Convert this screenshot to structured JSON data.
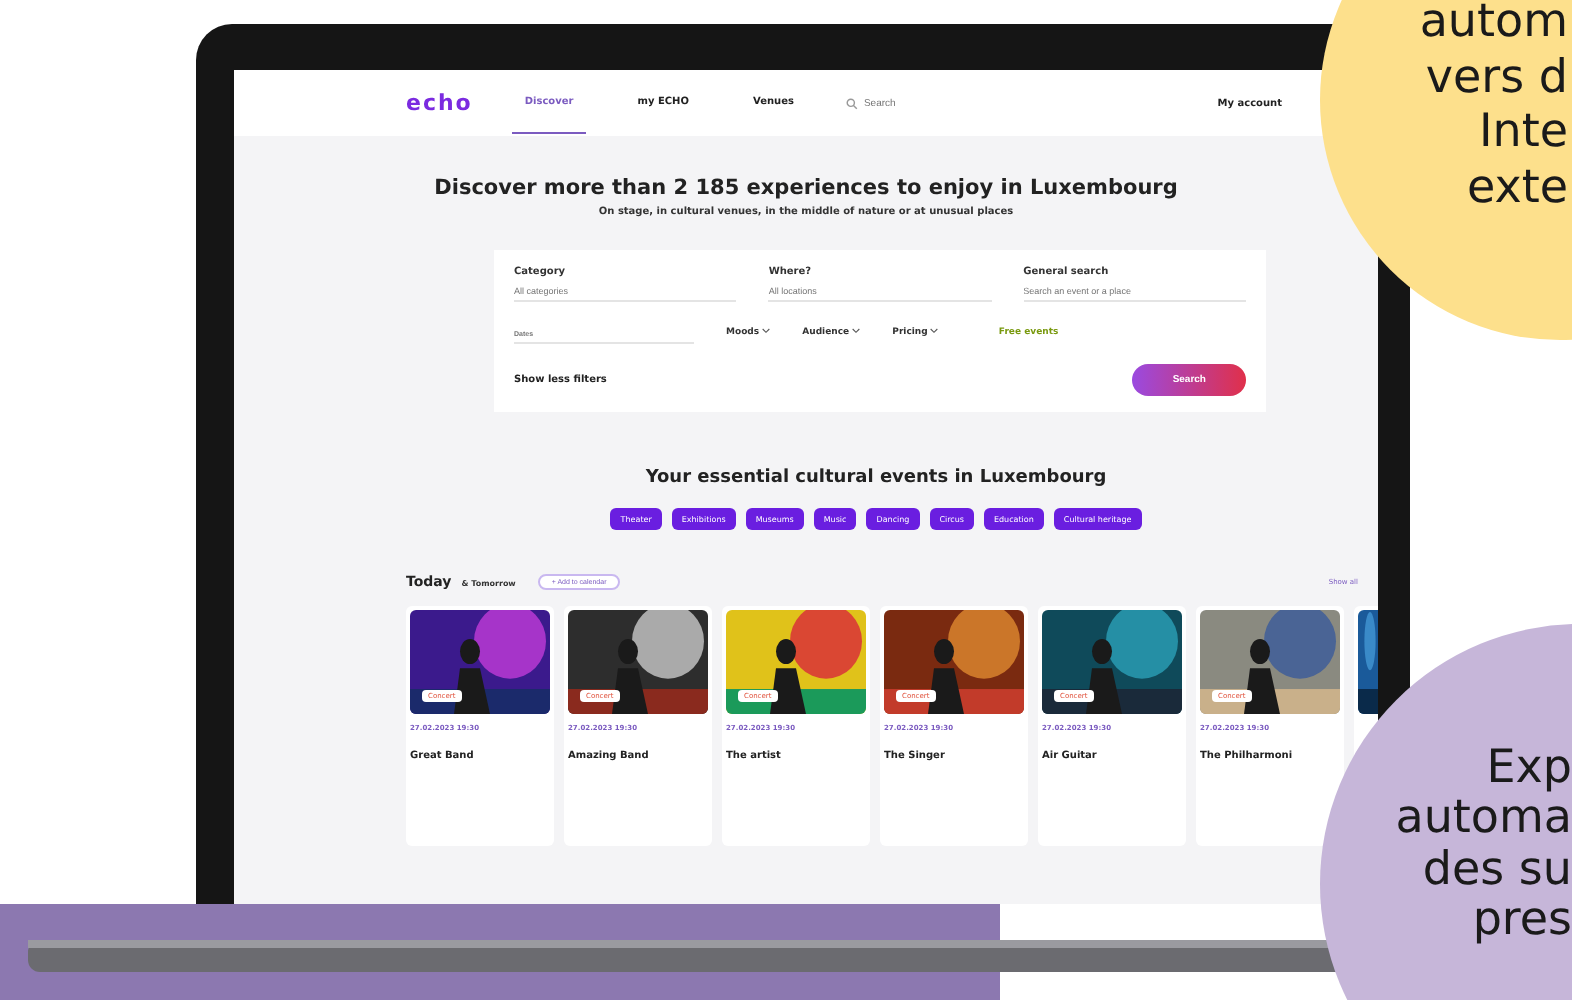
{
  "nav": {
    "logo": "echo",
    "items": [
      {
        "label": "Discover",
        "selected": true
      },
      {
        "label": "my ECHO",
        "selected": false
      },
      {
        "label": "Venues",
        "selected": false
      }
    ],
    "search": {
      "placeholder": "Search"
    },
    "account": "My account"
  },
  "hero": {
    "title": "Discover more than 2 185 experiences to enjoy in Luxembourg",
    "subtitle": "On stage, in cultural venues, in the middle of nature or at unusual places"
  },
  "filters": {
    "fields": [
      {
        "label": "Category",
        "placeholder": "All categories"
      },
      {
        "label": "Where?",
        "placeholder": "All locations"
      },
      {
        "label": "General search",
        "placeholder": "Search an event or a place"
      }
    ],
    "date": {
      "placeholder": "Dates"
    },
    "dropdowns": [
      "Moods",
      "Audience",
      "Pricing"
    ],
    "toggle": "Free events",
    "more": "Show less filters",
    "submit": "Search"
  },
  "categories": {
    "title": "Your essential cultural events in Luxembourg",
    "chips": [
      "Theater",
      "Exhibitions",
      "Museums",
      "Music",
      "Dancing",
      "Circus",
      "Education",
      "Cultural heritage"
    ]
  },
  "today": {
    "title": "Today",
    "subtitle": "& Tomorrow",
    "add": "+ Add to calendar",
    "more": "Show all"
  },
  "events": [
    {
      "badge": "Concert",
      "date": "27.02.2023 19:30",
      "title": "Great Band"
    },
    {
      "badge": "Concert",
      "date": "27.02.2023 19:30",
      "title": "Amazing Band"
    },
    {
      "badge": "Concert",
      "date": "27.02.2023 19:30",
      "title": "The artist"
    },
    {
      "badge": "Concert",
      "date": "27.02.2023 19:30",
      "title": "The Singer"
    },
    {
      "badge": "Concert",
      "date": "27.02.2023 19:30",
      "title": "Air Guitar"
    },
    {
      "badge": "Concert",
      "date": "27.02.2023 19:30",
      "title": "The Philharmoni"
    }
  ],
  "bubbles": [
    {
      "lines": [
        "autom",
        "vers d",
        "Inte",
        "exte"
      ],
      "color": "#fde08c"
    },
    {
      "lines": [
        "Exp",
        "automa",
        "des su",
        "pres"
      ],
      "color": "#c6b6d9"
    }
  ]
}
